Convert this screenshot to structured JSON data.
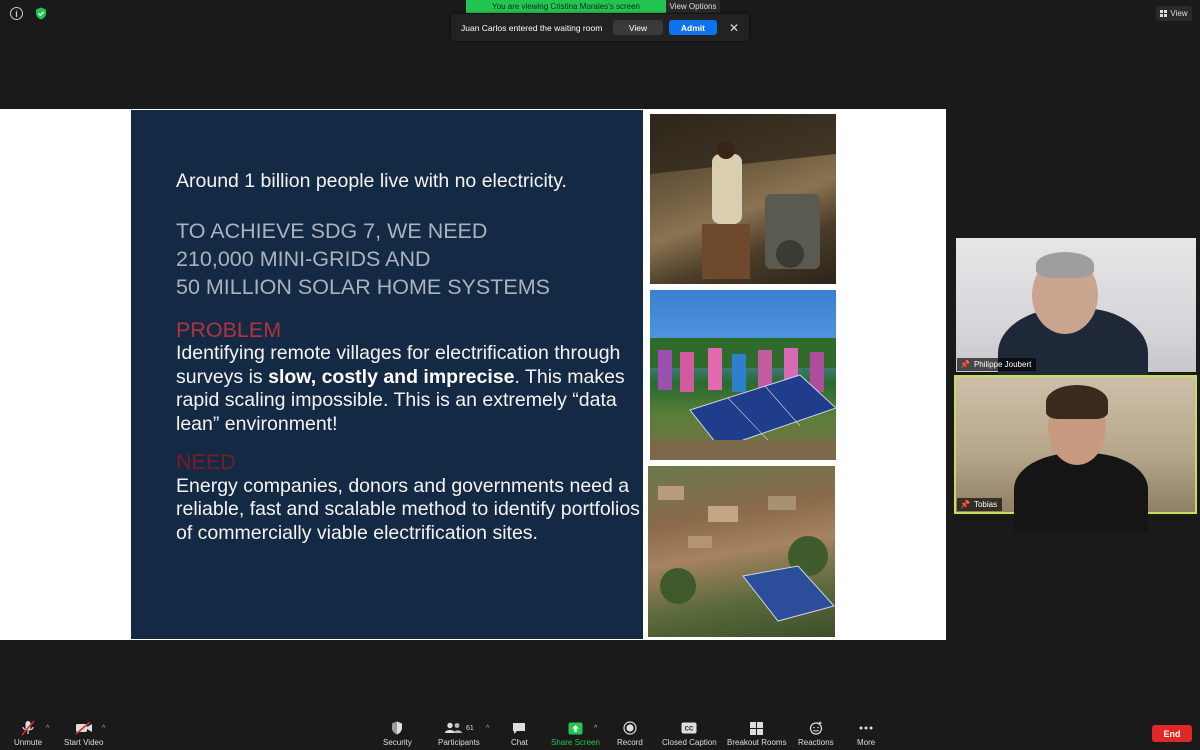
{
  "banner": {
    "viewing": "You are viewing Cristina Morales's screen",
    "view_options": "View Options ⌄"
  },
  "toast": {
    "message": "Juan Carlos entered the waiting room",
    "view": "View",
    "admit": "Admit",
    "close": "✕"
  },
  "view_button": "View",
  "slide": {
    "lead": "Around 1 billion people live with no electricity.",
    "goal_lines": [
      "TO ACHIEVE SDG 7, WE NEED",
      "210,000 MINI-GRIDS AND",
      "50 MILLION SOLAR HOME SYSTEMS"
    ],
    "problem_head": "PROBLEM",
    "problem_pre": "Identifying remote villages for electrification through surveys is ",
    "problem_bold": "slow, costly and imprecise",
    "problem_post": ". This makes rapid scaling impossible. This is an extremely “data lean” environment!",
    "need_head": "NEED",
    "need_text": "Energy companies, donors and governments need a reliable, fast and scalable method to identify portfolios of commercially viable electrification sites."
  },
  "participants": [
    {
      "name": "Philippe Joubert"
    },
    {
      "name": "Tobias"
    }
  ],
  "toolbar": {
    "unmute": "Unmute",
    "start_video": "Start Video",
    "security": "Security",
    "participants": "Participants",
    "participants_count": "61",
    "chat": "Chat",
    "share_screen": "Share Screen",
    "record": "Record",
    "closed_caption": "Closed Caption",
    "breakout_rooms": "Breakout Rooms",
    "reactions": "Reactions",
    "more": "More",
    "end": "End"
  },
  "colors": {
    "share_green": "#23c552",
    "admit_blue": "#0e72ed",
    "end_red": "#e02828",
    "slide_navy": "#142a44",
    "problem_red": "#b3323e",
    "active_speaker": "#c4e05a"
  },
  "icons": [
    "info-icon",
    "shield-icon",
    "pin-icon",
    "microphone-muted-icon",
    "video-off-icon",
    "security-shield-icon",
    "participants-icon",
    "chat-icon",
    "share-screen-icon",
    "record-icon",
    "closed-caption-icon",
    "breakout-rooms-icon",
    "reactions-icon",
    "more-icon"
  ]
}
